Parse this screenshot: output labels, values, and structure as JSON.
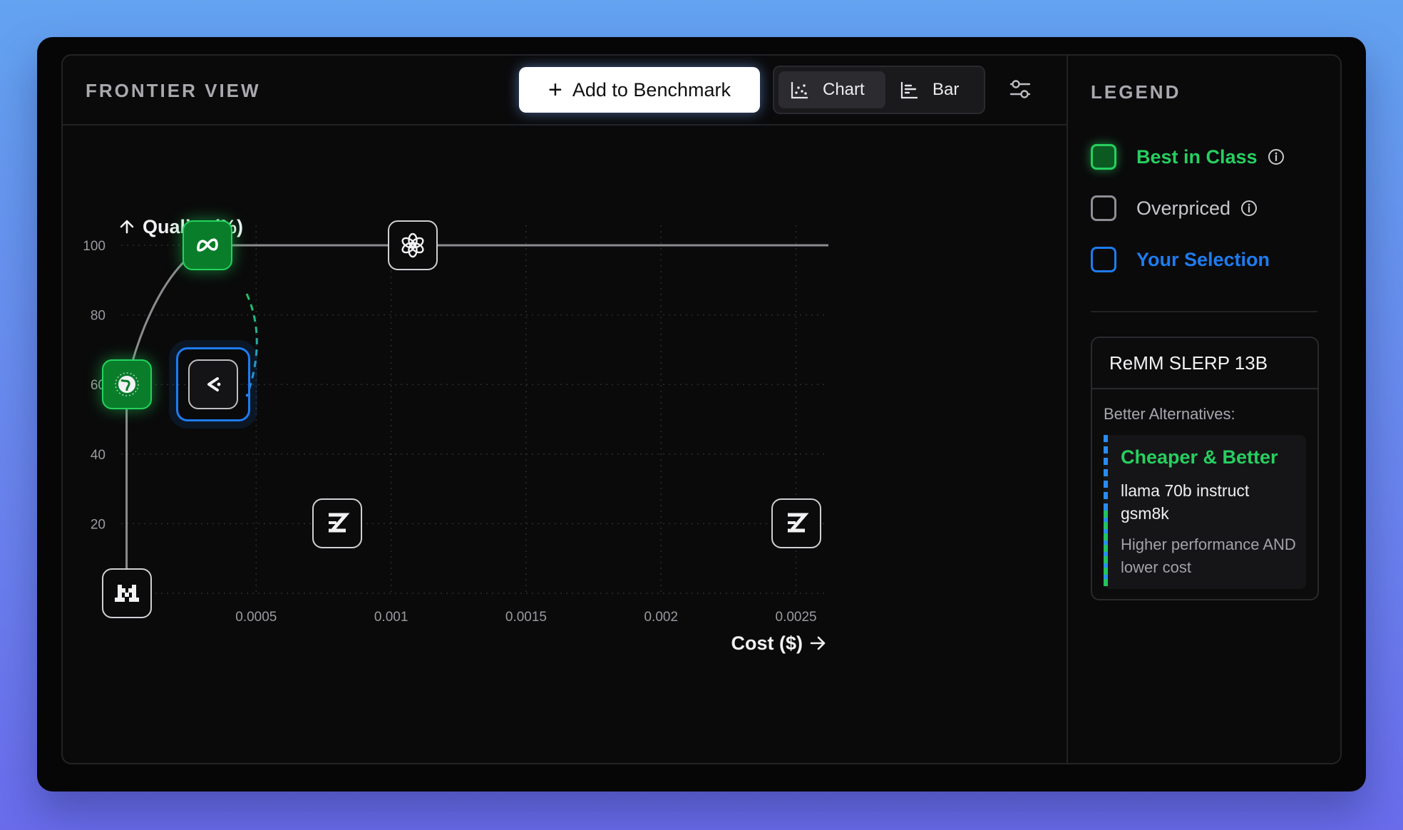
{
  "header": {
    "title": "FRONTIER VIEW",
    "add_button": "Add to Benchmark",
    "view_toggle": {
      "chart_label": "Chart",
      "bar_label": "Bar",
      "active": "Chart"
    }
  },
  "chart_data": {
    "type": "scatter",
    "ylabel": "Quality (%)",
    "xlabel": "Cost ($)",
    "y_ticks": [
      "100",
      "80",
      "60",
      "40",
      "20"
    ],
    "x_ticks": [
      "0.0005",
      "0.001",
      "0.0015",
      "0.002",
      "0.0025"
    ],
    "xlim": [
      0,
      0.00262
    ],
    "ylim": [
      0,
      100
    ],
    "grid": true,
    "points": [
      {
        "icon": "mistral-icon",
        "x": 2e-05,
        "y": 0,
        "status": "default"
      },
      {
        "icon": "globe-icon",
        "x": 2e-05,
        "y": 60,
        "status": "best"
      },
      {
        "icon": "meta-icon",
        "x": 0.00032,
        "y": 100,
        "status": "best"
      },
      {
        "icon": "openai-icon",
        "x": 0.00108,
        "y": 100,
        "status": "default"
      },
      {
        "icon": "chevron-left-icon",
        "x": 0.00034,
        "y": 60,
        "status": "selected"
      },
      {
        "icon": "z-logo-icon",
        "x": 0.0008,
        "y": 20,
        "status": "default"
      },
      {
        "icon": "z-logo-icon",
        "x": 0.0025,
        "y": 20,
        "status": "default"
      }
    ],
    "frontier": [
      [
        2e-05,
        0
      ],
      [
        2e-05,
        60
      ],
      [
        0.00032,
        100
      ],
      [
        0.00262,
        100
      ]
    ]
  },
  "legend": {
    "title": "LEGEND",
    "items": [
      {
        "label": "Best in Class",
        "color": "#27cf5f",
        "info": true
      },
      {
        "label": "Overpriced",
        "color": "#c8c8cc",
        "info": true
      },
      {
        "label": "Your Selection",
        "color": "#1e7cf0",
        "info": false
      }
    ]
  },
  "details": {
    "model": "ReMM SLERP 13B",
    "subtitle": "Better Alternatives:",
    "alt_title": "Cheaper & Better",
    "alt_name": "llama 70b instruct gsm8k",
    "alt_desc": "Higher performance AND lower cost"
  }
}
